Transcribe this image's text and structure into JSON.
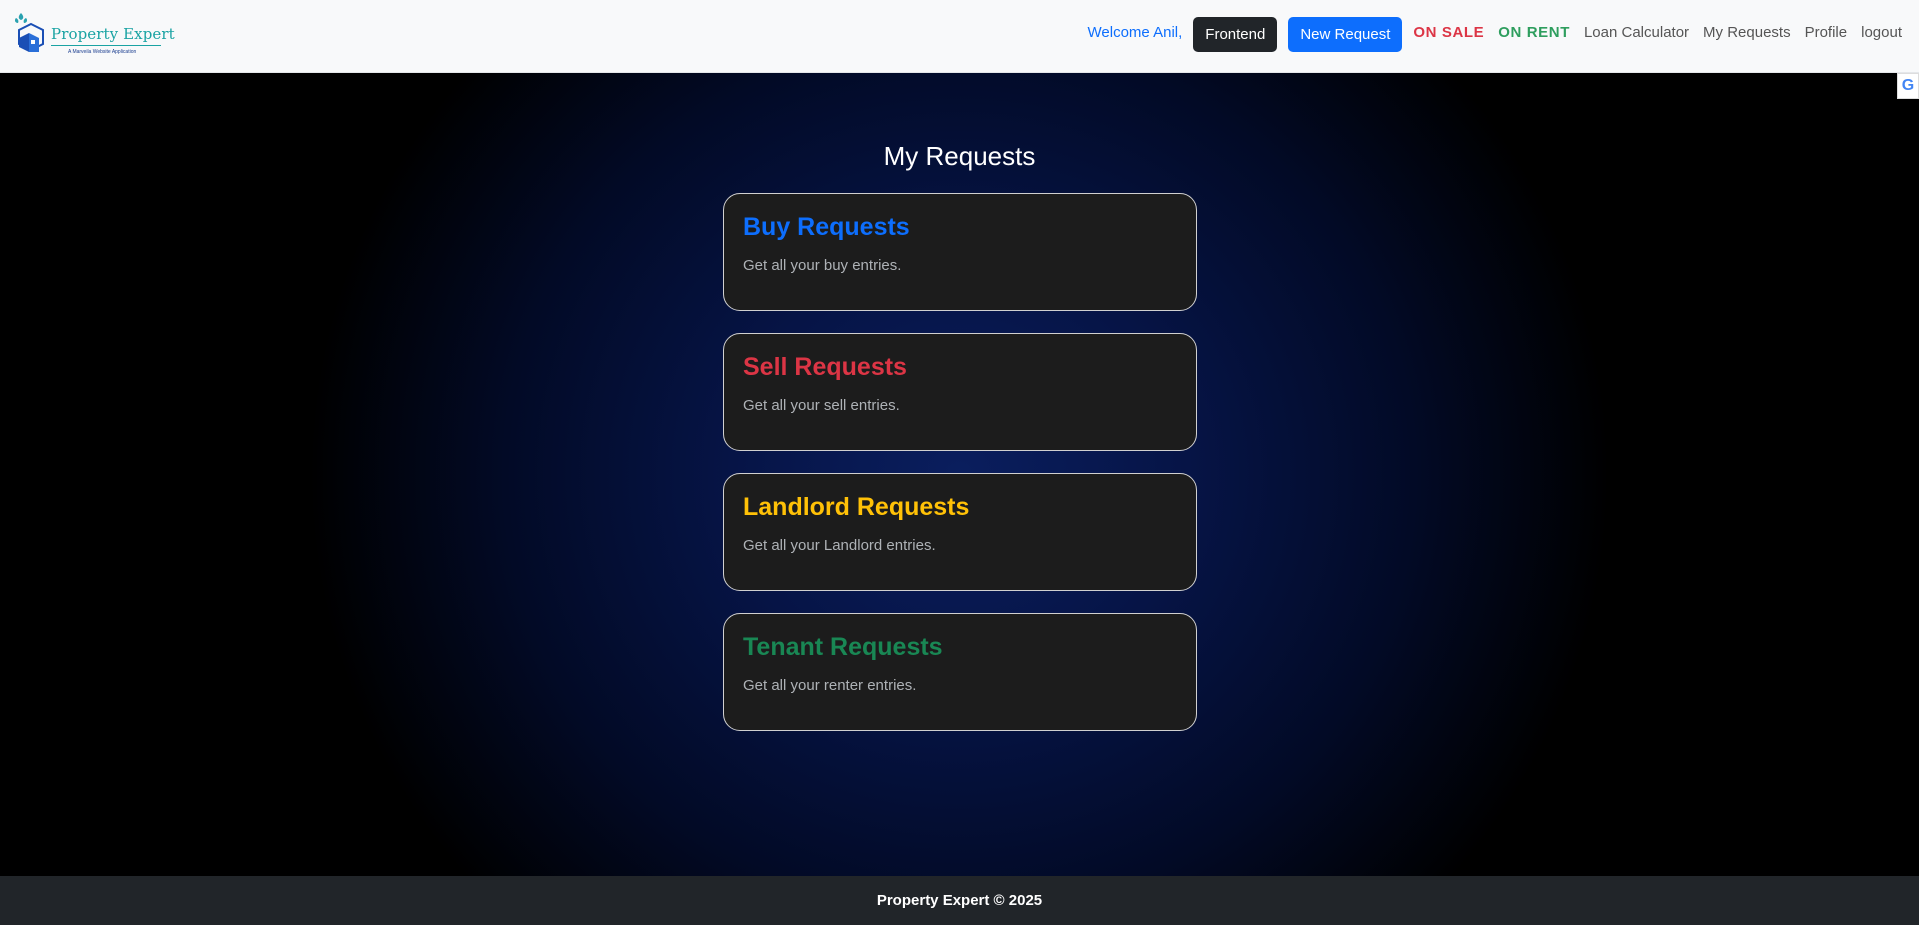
{
  "header": {
    "logo": {
      "name": "Property Expert",
      "tagline": "A Marveila Website Application"
    },
    "welcome": "Welcome Anil,",
    "buttons": {
      "frontend": "Frontend",
      "new_request": "New Request"
    },
    "nav": {
      "on_sale": "ON SALE",
      "on_rent": "ON RENT",
      "loan_calculator": "Loan Calculator",
      "my_requests": "My Requests",
      "profile": "Profile",
      "logout": "logout"
    },
    "translate_badge": "G"
  },
  "main": {
    "title": "My Requests",
    "cards": [
      {
        "title": "Buy Requests",
        "text": "Get all your buy entries.",
        "color": "#0d6efd"
      },
      {
        "title": "Sell Requests",
        "text": "Get all your sell entries.",
        "color": "#dc3545"
      },
      {
        "title": "Landlord Requests",
        "text": "Get all your Landlord entries.",
        "color": "#ffc107"
      },
      {
        "title": "Tenant Requests",
        "text": "Get all your renter entries.",
        "color": "#198754"
      }
    ]
  },
  "footer": {
    "text": "Property Expert © 2025"
  },
  "colors": {
    "accent": "#0d6efd",
    "danger": "#dc3545",
    "success": "#198754",
    "warning": "#ffc107",
    "footer_bg": "#212529"
  }
}
